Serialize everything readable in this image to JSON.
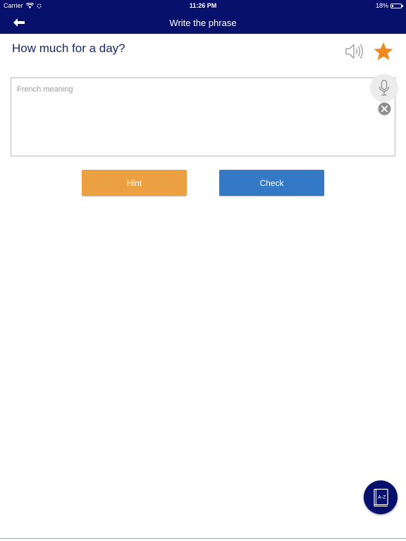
{
  "status_bar": {
    "carrier": "Carrier",
    "time": "11:26 PM",
    "battery": "18%",
    "battery_level": 0.18
  },
  "nav": {
    "title": "Write the phrase",
    "back_icon": "arrow-left-icon"
  },
  "phrase": {
    "text": "How much for a day?",
    "speaker_icon": "speaker-icon",
    "favorite_icon": "star-icon"
  },
  "answer": {
    "placeholder": "French meaning",
    "value": "",
    "mic_icon": "microphone-icon",
    "clear_icon": "close-circle-icon"
  },
  "buttons": {
    "hint_label": "Hint",
    "check_label": "Check"
  },
  "dictionary": {
    "label": "A-Z",
    "icon": "dictionary-book-icon"
  },
  "colors": {
    "nav_background": "#07116b",
    "phrase_text": "#16286e",
    "hint": "#eba141",
    "check": "#3479c5",
    "star": "#f08a1e"
  }
}
